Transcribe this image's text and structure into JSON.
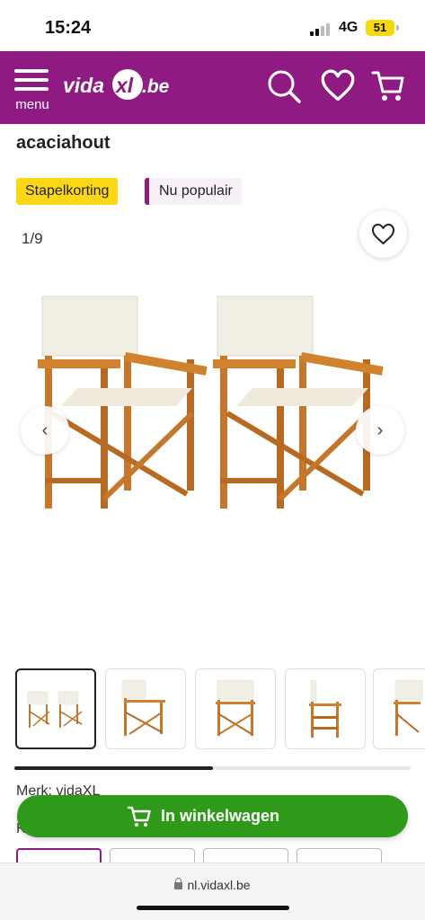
{
  "status_bar": {
    "time": "15:24",
    "network": "4G",
    "battery": "51"
  },
  "header": {
    "menu_label": "menu",
    "logo_text": "vidaXL.be",
    "icons": [
      "search-icon",
      "heart-icon",
      "cart-icon"
    ],
    "brand_color": "#8e1a82"
  },
  "product": {
    "title_line": "acaciahout",
    "badges": {
      "bulk_discount": "Stapelkorting",
      "popular": "Nu populair"
    },
    "image_counter": "1/9",
    "thumbnail_count_visible": 5,
    "gallery_scroll_fraction": 0.5,
    "brand_line": "Merk: vidaXL",
    "next_label": "K"
  },
  "cart": {
    "button_label": "In winkelwagen",
    "button_color": "#2f9a19"
  },
  "browser": {
    "url": "nl.vidaxl.be"
  }
}
